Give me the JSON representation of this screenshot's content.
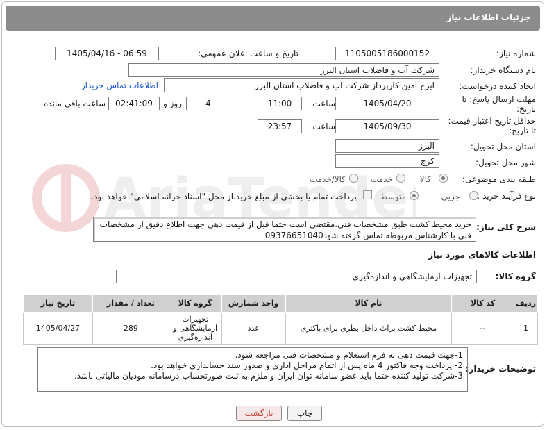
{
  "header": {
    "title": "جزئیات اطلاعات نیاز"
  },
  "form": {
    "need_number_label": "شماره نیاز:",
    "need_number": "1105005186000152",
    "announce_label": "تاریخ و ساعت اعلان عمومی:",
    "announce_value": "1405/04/16 - 06:59",
    "buyer_org_label": "نام دستگاه خریدار:",
    "buyer_org": "شرکت آب و فاضلاب استان البرز",
    "requester_label": "ایجاد کننده درخواست:",
    "requester": "ایرج امین کارپرداز شرکت آب و فاضلاب استان البرز",
    "contact_link": "اطلاعات تماس خریدار",
    "deadline_label_1": "مهلت ارسال پاسخ: تا",
    "deadline_label_2": "تاریخ:",
    "deadline_date": "1405/04/20",
    "time_label": "ساعت",
    "deadline_time": "11:00",
    "days_value": "4",
    "days_label": "روز و",
    "remaining_time": "02:41:09",
    "remaining_label": "ساعت باقی مانده",
    "validity_label_1": "حداقل تاریخ اعتبار قیمت:",
    "validity_label_2": "تا تاریخ:",
    "validity_date": "1405/09/30",
    "validity_time": "23:57",
    "province_label": "استان محل تحویل:",
    "province": "البرز",
    "city_label": "شهر محل تحویل:",
    "city": "کرج",
    "category_label": "طبقه بندی موضوعی:",
    "category_options": [
      "کالا",
      "خدمت",
      "کالا/خدمت"
    ],
    "process_label": "نوع فرآیند خرید :",
    "process_options": [
      "جزیی",
      "متوسط"
    ],
    "payment_note": "پرداخت تمام یا بخشی از مبلغ خرید،از محل \"اسناد خزانه اسلامی\" خواهد بود."
  },
  "description": {
    "label": "شرح کلی نیاز:",
    "text": "خرید محیط کشت طبق مشخصات فنی.مقتضی است حتما قبل از قیمت دهی جهت اطلاع دقیق از مشخصات فنی با کارشناس مربوطه تماس گرفته شود09376651040"
  },
  "goods": {
    "section_title": "اطلاعات کالاهای مورد نیاز",
    "group_label": "گروه کالا:",
    "group_value": "تجهیزات آزمایشگاهی و اندازه‌گیری",
    "columns": [
      "ردیف",
      "کد کالا",
      "نام کالا",
      "واحد شمارش",
      "گروه کالا",
      "تعداد / مقدار",
      "تاریخ نیاز"
    ],
    "rows": [
      [
        "1",
        "--",
        "محیط کشت براث داخل بطری برای باکتری",
        "عدد",
        "تجهیزات آزمایشگاهی و اندازه‌گیری",
        "289",
        "1405/04/27"
      ]
    ]
  },
  "buyer_notes": {
    "label": "توضیحات خریدار:",
    "lines": [
      "1-جهت قیمت دهی به فرم استعلام و مشخصات فنی مراجعه شود.",
      "2- پرداخت وجه فاکتور 4 ماه پس از اتمام مراحل اداری و صدور سند حسابداری خواهد بود.",
      "3-شرکت تولید کننده حتما باید عضو سامانه توان ایران و ملزم به ثبت صورتحساب درسامانه مودیان مالیاتی باشد."
    ]
  },
  "buttons": {
    "print": "چاپ",
    "back": "بازگشت"
  },
  "colors": {
    "header_bg": "#8c8c8c",
    "link": "#1a56c9",
    "back_text": "#c0392b"
  }
}
